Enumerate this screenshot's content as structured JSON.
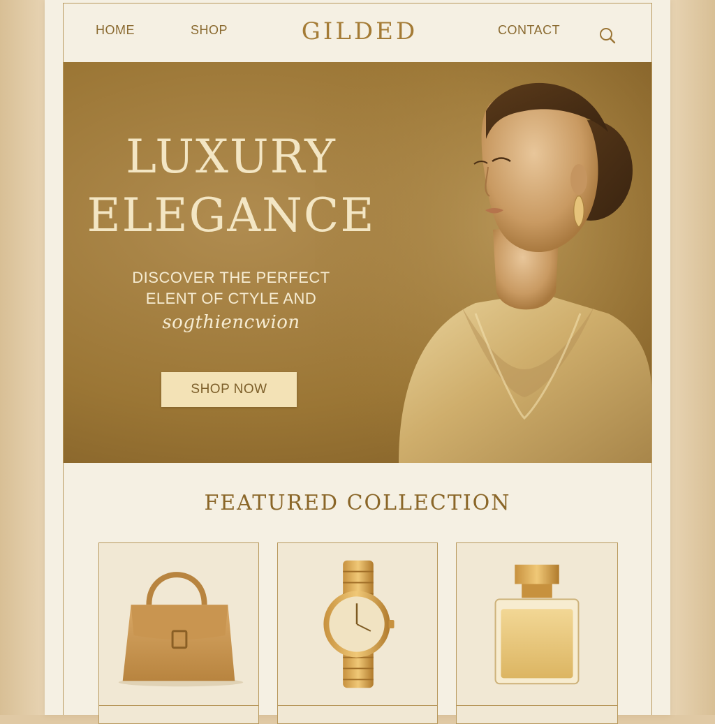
{
  "brand": "GILDED",
  "nav": {
    "links": [
      "HOME",
      "SHOP",
      "CONTACT"
    ],
    "search_icon": "search-icon"
  },
  "hero": {
    "title_line1": "LUXURY",
    "title_line2": "ELEGANCE",
    "subtitle_line1": "DISCOVER THE PERFECT",
    "subtitle_line2": "ELENT OF CTYLE AND",
    "subtitle_line3": "sogthiencwion",
    "cta_label": "SHOP NOW"
  },
  "featured": {
    "title": "FEATURED COLLECTION",
    "products": [
      {
        "icon": "handbag-icon"
      },
      {
        "icon": "watch-icon"
      },
      {
        "icon": "perfume-bottle-icon"
      }
    ]
  },
  "colors": {
    "accent_gold": "#a47b35",
    "hero_bg": "#9b7635",
    "page_cream": "#f5f0e3",
    "button_bg": "#f3e2b6"
  }
}
